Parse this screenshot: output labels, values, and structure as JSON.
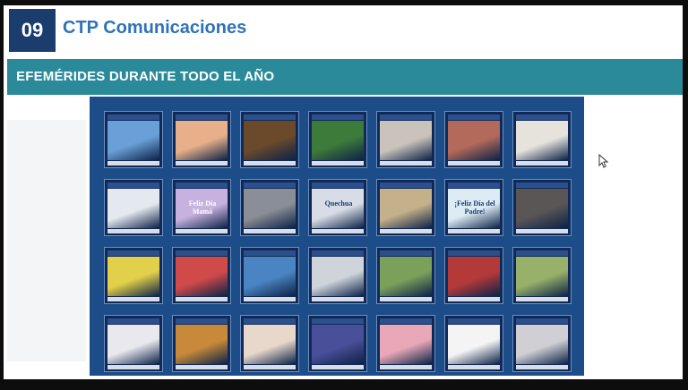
{
  "slide": {
    "number": "09",
    "title": "CTP Comunicaciones",
    "section_heading": "EFEMÉRIDES DURANTE TODO EL AÑO"
  },
  "grid": {
    "rows": 4,
    "cols": 7,
    "tiles": [
      {
        "kind": "building",
        "color": "#6aa0d8"
      },
      {
        "kind": "hands-heart",
        "color": "#e8b08a"
      },
      {
        "kind": "globe",
        "color": "#6a4a2a"
      },
      {
        "kind": "plant",
        "color": "#3d7b3a"
      },
      {
        "kind": "people",
        "color": "#c9c3bb"
      },
      {
        "kind": "crowd",
        "color": "#b46a5a"
      },
      {
        "kind": "calligraphy",
        "color": "#e6e3dc"
      },
      {
        "kind": "woman-phone",
        "color": "#e4e8ef"
      },
      {
        "kind": "feliz-dia-mama",
        "color": "#c7b1de"
      },
      {
        "kind": "station",
        "color": "#8a8e96"
      },
      {
        "kind": "quechua-words",
        "color": "#d8dce6"
      },
      {
        "kind": "pushkin-portrait",
        "color": "#c4b08a"
      },
      {
        "kind": "feliz-dia-padre",
        "color": "#dcebf4"
      },
      {
        "kind": "fence",
        "color": "#5a5656"
      },
      {
        "kind": "map",
        "color": "#e2cf4a"
      },
      {
        "kind": "rainbow-girl",
        "color": "#d04a4a"
      },
      {
        "kind": "kids",
        "color": "#4a84c2"
      },
      {
        "kind": "teacher",
        "color": "#cfd4db"
      },
      {
        "kind": "machu-picchu",
        "color": "#7aa05a"
      },
      {
        "kind": "andean-people",
        "color": "#b43a3a"
      },
      {
        "kind": "sitting-kids",
        "color": "#97b06a"
      },
      {
        "kind": "flags",
        "color": "#e8e8ee"
      },
      {
        "kind": "peace-hands",
        "color": "#c88a3a"
      },
      {
        "kind": "sign-language",
        "color": "#e8d8cc"
      },
      {
        "kind": "infographic",
        "color": "#4a4f9a"
      },
      {
        "kind": "ribbon-hands",
        "color": "#e8a8b8"
      },
      {
        "kind": "writing",
        "color": "#f4f4f4"
      },
      {
        "kind": "stop-woman",
        "color": "#cfcfd4"
      }
    ]
  },
  "tile_texts": {
    "feliz_dia_mama": "Feliz Día Mamá",
    "quechua": "Quechua",
    "feliz_dia_padre": "¡Feliz Día del Padre!"
  },
  "icons": {
    "cursor": "mouse-pointer-icon"
  }
}
